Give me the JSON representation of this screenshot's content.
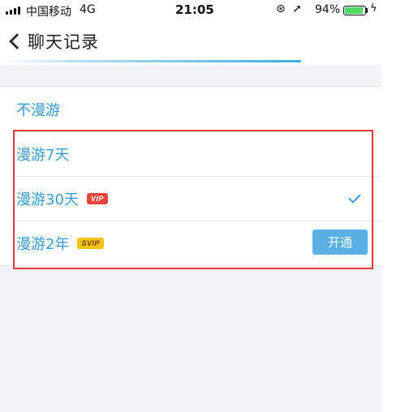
{
  "status_bar": {
    "carrier": "中国移动",
    "network": "4G",
    "time": "21:05",
    "battery_percent": "94%",
    "battery_level": 0.94
  },
  "nav": {
    "title": "聊天记录",
    "progress": 0.79
  },
  "options": [
    {
      "label": "不漫游"
    },
    {
      "label": "漫游7天"
    },
    {
      "label": "漫游30天",
      "badge": "VIP",
      "selected": true
    },
    {
      "label": "漫游2年",
      "badge": "SVIP",
      "action": "开通"
    }
  ],
  "colors": {
    "accent": "#3a9ad9",
    "vip_badge": "#e8453c",
    "svip_badge": "#f2c400",
    "highlight_box": "#e03a3a"
  }
}
